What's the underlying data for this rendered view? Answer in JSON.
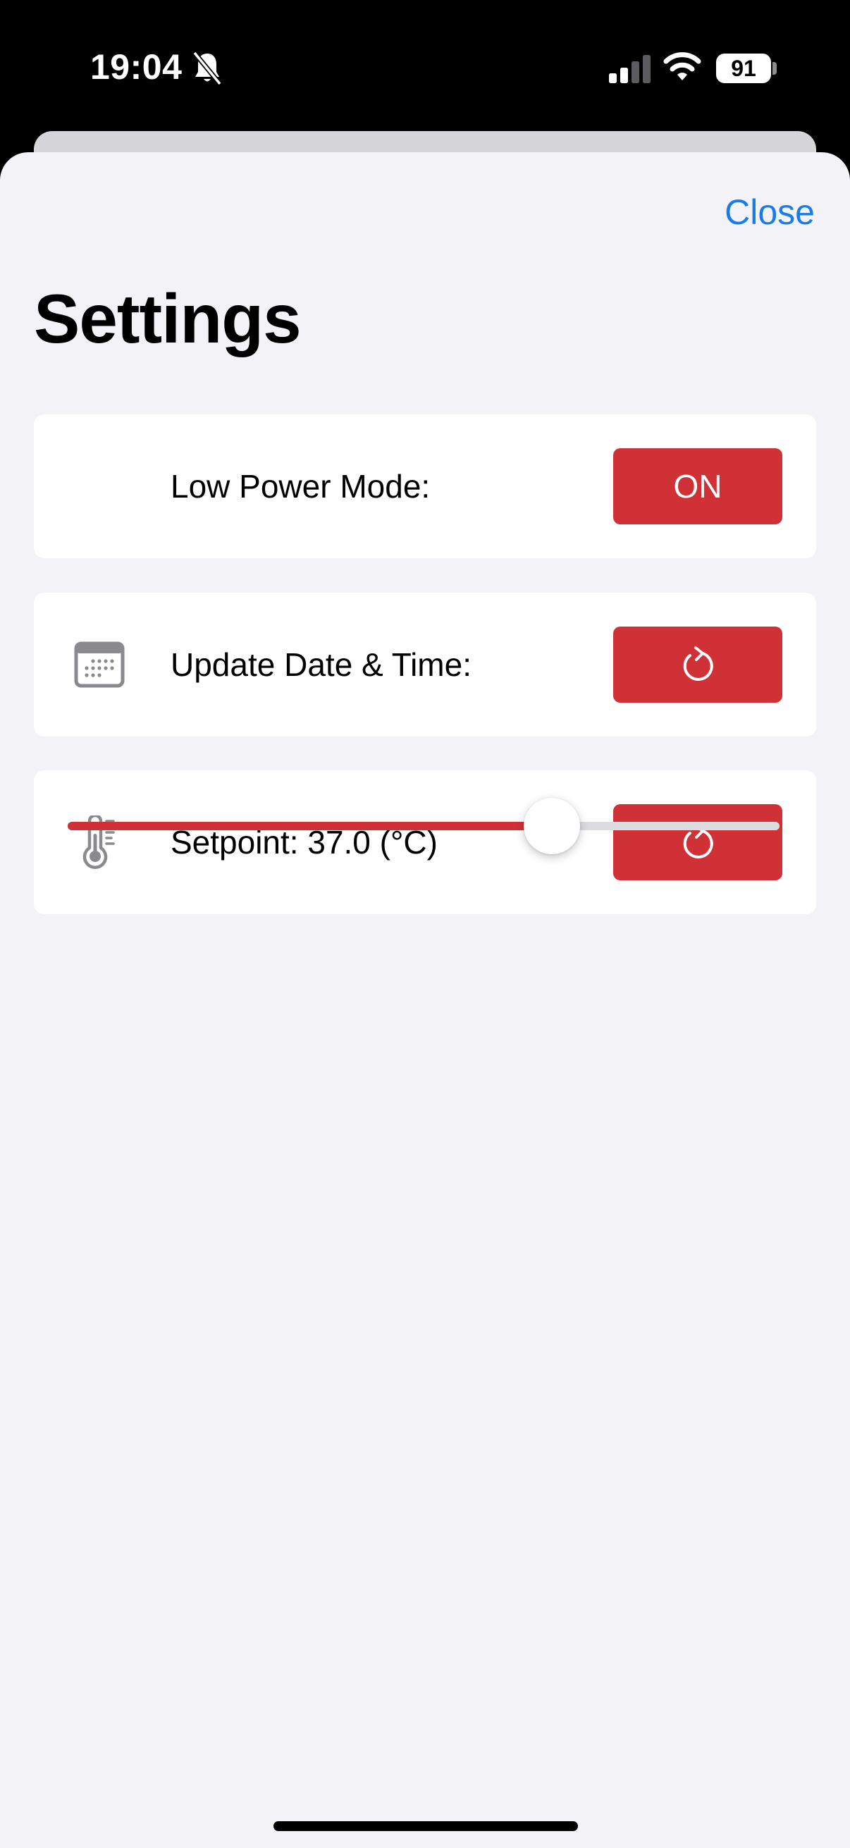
{
  "status_bar": {
    "time": "19:04",
    "battery_level": "91",
    "icons": [
      "bell-slash-icon",
      "cellular-signal-icon",
      "wifi-icon",
      "battery-icon"
    ]
  },
  "header": {
    "close_label": "Close",
    "title": "Settings"
  },
  "settings": {
    "low_power": {
      "label": "Low Power Mode:",
      "button_label": "ON"
    },
    "update_time": {
      "label": "Update Date & Time:",
      "icon": "calendar-icon",
      "button_icon": "refresh-icon"
    },
    "setpoint": {
      "label": "Setpoint: 37.0 (°C)",
      "icon": "thermometer-icon",
      "button_icon": "refresh-icon"
    }
  },
  "slider": {
    "value_fraction": 0.68
  },
  "colors": {
    "accent": "#d03137",
    "link": "#1a7ce8",
    "background": "#f2f2f7",
    "card": "#ffffff"
  }
}
